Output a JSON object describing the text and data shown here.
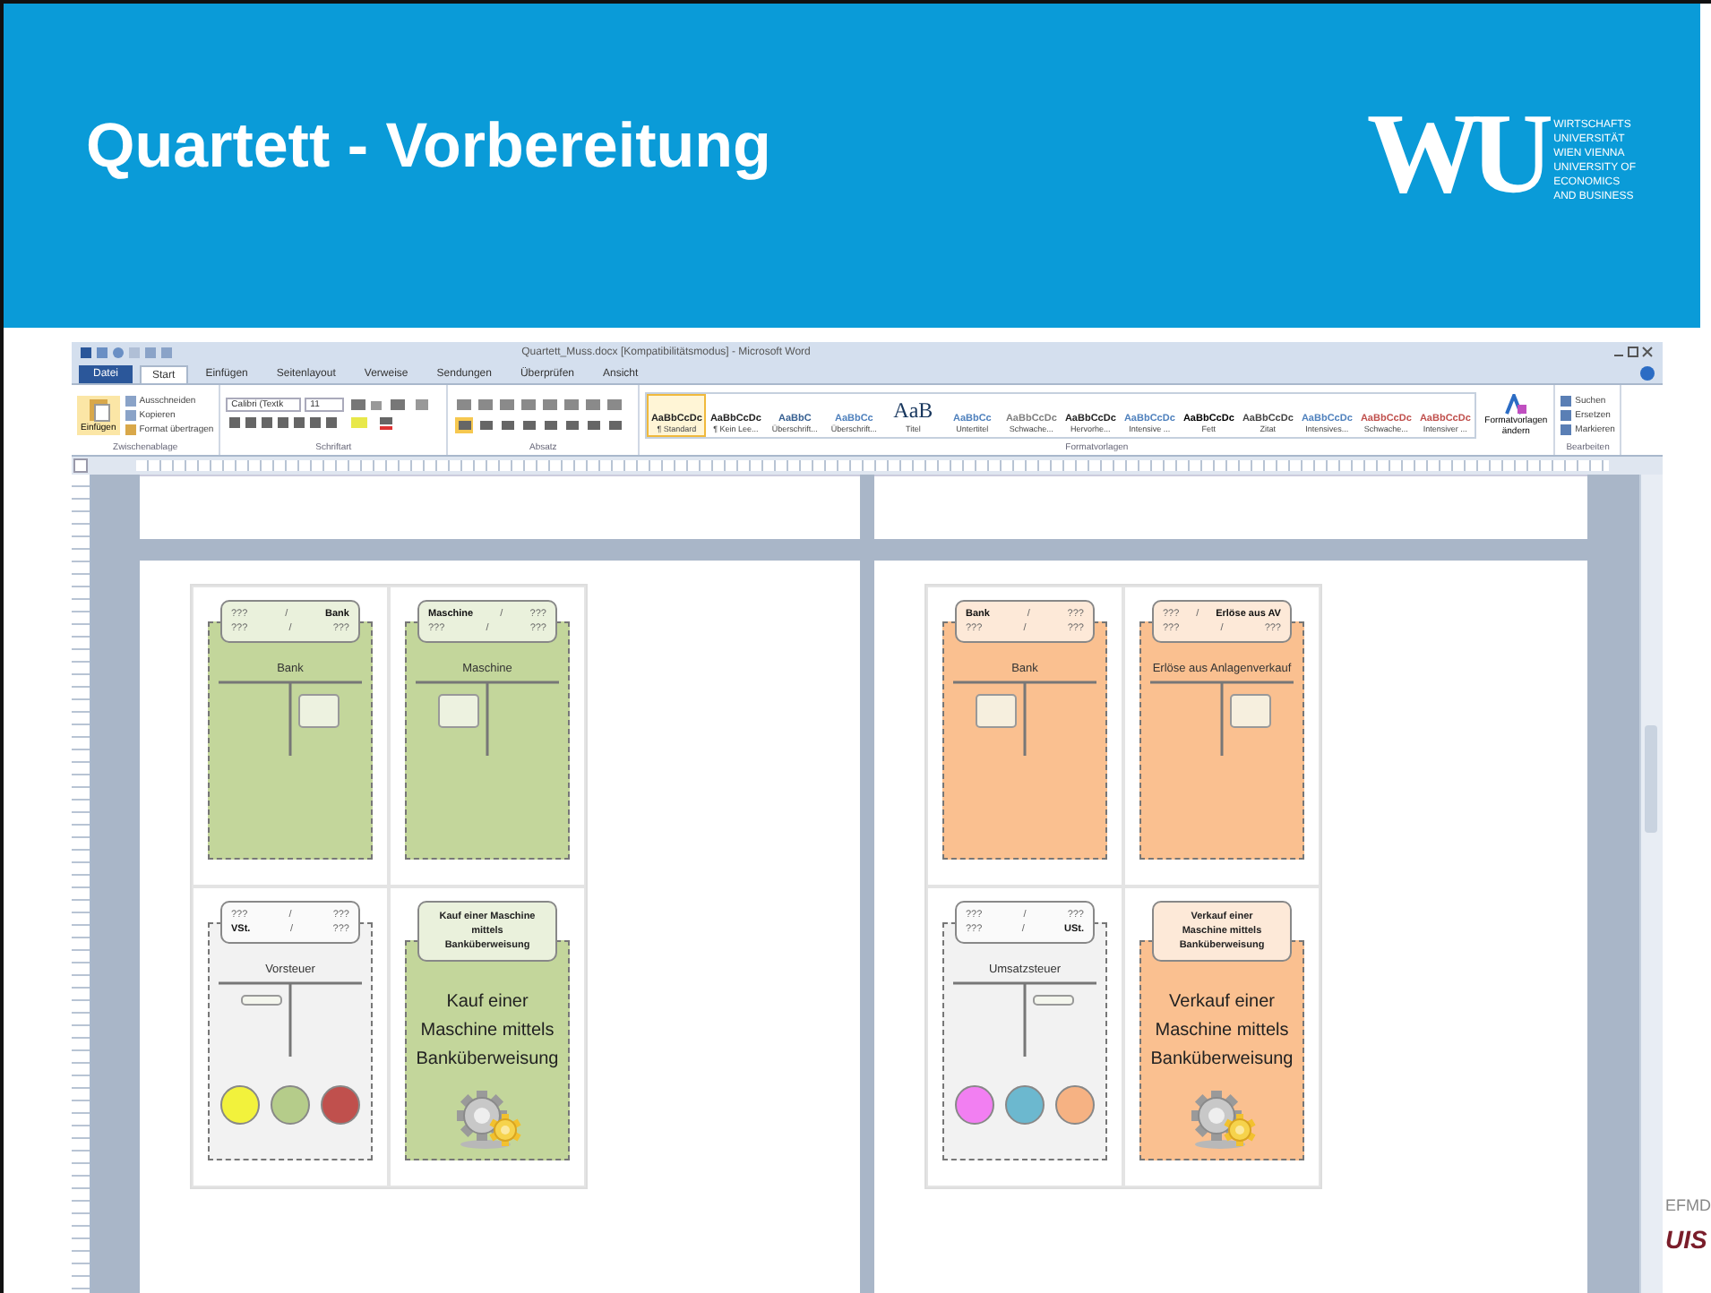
{
  "slide": {
    "title": "Quartett - Vorbereitung",
    "logo": {
      "mark": "WU",
      "lines": [
        "WIRTSCHAFTS",
        "UNIVERSITÄT",
        "WIEN VIENNA",
        "UNIVERSITY OF",
        "ECONOMICS",
        "AND BUSINESS"
      ]
    },
    "corner_texts": [
      "EFMD",
      "UIS"
    ]
  },
  "word": {
    "title": "Quartett_Muss.docx [Kompatibilitätsmodus] - Microsoft Word",
    "tabs": [
      {
        "label": "Datei",
        "selected": false,
        "kind": "file"
      },
      {
        "label": "Start",
        "selected": true,
        "kind": "tab"
      },
      {
        "label": "Einfügen",
        "selected": false,
        "kind": "tab"
      },
      {
        "label": "Seitenlayout",
        "selected": false,
        "kind": "tab"
      },
      {
        "label": "Verweise",
        "selected": false,
        "kind": "tab"
      },
      {
        "label": "Sendungen",
        "selected": false,
        "kind": "tab"
      },
      {
        "label": "Überprüfen",
        "selected": false,
        "kind": "tab"
      },
      {
        "label": "Ansicht",
        "selected": false,
        "kind": "tab"
      }
    ],
    "clipboard": {
      "label": "Zwischenablage",
      "paste": "Einfügen",
      "items": [
        "Ausschneiden",
        "Kopieren",
        "Format übertragen"
      ]
    },
    "font": {
      "label": "Schriftart",
      "family": "Calibri (Textk",
      "size": "11"
    },
    "paragraph": {
      "label": "Absatz"
    },
    "styles": {
      "label": "Formatvorlagen",
      "change": "Formatvorlagen ändern",
      "items": [
        {
          "preview": "AaBbCcDc",
          "name": "¶ Standard",
          "selected": true,
          "color": "#222222"
        },
        {
          "preview": "AaBbCcDc",
          "name": "¶ Kein Lee...",
          "selected": false,
          "color": "#222222"
        },
        {
          "preview": "AaBbC",
          "name": "Überschrift...",
          "selected": false,
          "color": "#365f91"
        },
        {
          "preview": "AaBbCc",
          "name": "Überschrift...",
          "selected": false,
          "color": "#4f81bd"
        },
        {
          "preview": "AaB",
          "name": "Titel",
          "selected": false,
          "color": "#17365d"
        },
        {
          "preview": "AaBbCc",
          "name": "Untertitel",
          "selected": false,
          "color": "#4f81bd"
        },
        {
          "preview": "AaBbCcDc",
          "name": "Schwache...",
          "selected": false,
          "color": "#7f7f7f"
        },
        {
          "preview": "AaBbCcDc",
          "name": "Hervorhe...",
          "selected": false,
          "color": "#222222"
        },
        {
          "preview": "AaBbCcDc",
          "name": "Intensive ...",
          "selected": false,
          "color": "#4f81bd"
        },
        {
          "preview": "AaBbCcDc",
          "name": "Fett",
          "selected": false,
          "color": "#000000"
        },
        {
          "preview": "AaBbCcDc",
          "name": "Zitat",
          "selected": false,
          "color": "#444444"
        },
        {
          "preview": "AaBbCcDc",
          "name": "Intensives...",
          "selected": false,
          "color": "#4f81bd"
        },
        {
          "preview": "AaBbCcDc",
          "name": "Schwache...",
          "selected": false,
          "color": "#c0504d"
        },
        {
          "preview": "AaBbCcDc",
          "name": "Intensiver ...",
          "selected": false,
          "color": "#c0504d"
        }
      ]
    },
    "editing": {
      "label": "Bearbeiten",
      "items": [
        "Suchen",
        "Ersetzen",
        "Markieren"
      ]
    }
  },
  "document": {
    "pages": [
      {
        "cards": [
          {
            "kind": "account",
            "color": "#c3d69b",
            "label_rows": [
              {
                "left": "???",
                "left_bold": false,
                "sep": "/",
                "right": "Bank",
                "right_bold": true
              },
              {
                "left": "???",
                "left_bold": false,
                "sep": "/",
                "right": "???",
                "right_bold": false
              }
            ],
            "account": "Bank",
            "entry_on_left": false,
            "entry_slim": false
          },
          {
            "kind": "account",
            "color": "#c3d69b",
            "label_rows": [
              {
                "left": "Maschine",
                "left_bold": true,
                "sep": "/",
                "right": "???",
                "right_bold": false
              },
              {
                "left": "???",
                "left_bold": false,
                "sep": "/",
                "right": "???",
                "right_bold": false
              }
            ],
            "account": "Maschine",
            "entry_on_left": true,
            "entry_slim": false
          },
          {
            "kind": "account",
            "color": "#f2f2f2",
            "label_rows": [
              {
                "left": "???",
                "left_bold": false,
                "sep": "/",
                "right": "???",
                "right_bold": false
              },
              {
                "left": "VSt.",
                "left_bold": true,
                "sep": "/",
                "right": "???",
                "right_bold": false
              }
            ],
            "account": "Vorsteuer",
            "entry_on_left": true,
            "entry_slim": true,
            "tokens": [
              {
                "color": "#f2f23c"
              },
              {
                "color": "#b5cc8a"
              },
              {
                "color": "#c0504d"
              }
            ]
          },
          {
            "kind": "event",
            "color": "#c3d69b",
            "label": "Kauf einer Maschine mittels Banküberweisung",
            "text": "Kauf einer Maschine mittels Banküberweisung"
          }
        ]
      },
      {
        "cards": [
          {
            "kind": "account",
            "color": "#fac090",
            "label_rows": [
              {
                "left": "Bank",
                "left_bold": true,
                "sep": "/",
                "right": "???",
                "right_bold": false
              },
              {
                "left": "???",
                "left_bold": false,
                "sep": "/",
                "right": "???",
                "right_bold": false
              }
            ],
            "account": "Bank",
            "entry_on_left": true,
            "entry_slim": false
          },
          {
            "kind": "account",
            "color": "#fac090",
            "label_rows": [
              {
                "left": "???",
                "left_bold": false,
                "sep": "/",
                "right": "Erlöse aus AV",
                "right_bold": true
              },
              {
                "left": "???",
                "left_bold": false,
                "sep": "/",
                "right": "???",
                "right_bold": false
              }
            ],
            "account": "Erlöse aus Anlagenverkauf",
            "entry_on_left": false,
            "entry_slim": false
          },
          {
            "kind": "account",
            "color": "#f2f2f2",
            "label_rows": [
              {
                "left": "???",
                "left_bold": false,
                "sep": "/",
                "right": "???",
                "right_bold": false
              },
              {
                "left": "???",
                "left_bold": false,
                "sep": "/",
                "right": "USt.",
                "right_bold": true
              }
            ],
            "account": "Umsatzsteuer",
            "entry_on_left": false,
            "entry_slim": true,
            "tokens": [
              {
                "color": "#f27ff2"
              },
              {
                "color": "#6cb8cf"
              },
              {
                "color": "#f6b283"
              }
            ]
          },
          {
            "kind": "event",
            "color": "#fac090",
            "label": "Verkauf einer Maschine mittels Banküberweisung",
            "text": "Verkauf einer Maschine mittels Banküberweisung"
          }
        ]
      }
    ]
  }
}
